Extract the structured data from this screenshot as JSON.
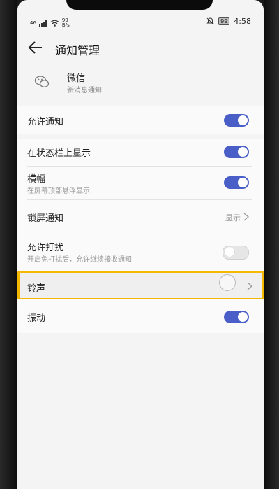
{
  "status_bar": {
    "signal_text": "46",
    "speed_top": "99",
    "speed_bottom": "B/s",
    "battery": "99",
    "time": "4:58"
  },
  "header": {
    "title": "通知管理"
  },
  "app": {
    "name": "微信",
    "subtitle": "新消息通知"
  },
  "settings": {
    "allow_notifications": {
      "label": "允许通知",
      "enabled": true
    },
    "status_bar_display": {
      "label": "在状态栏上显示",
      "enabled": true
    },
    "banner": {
      "label": "横幅",
      "sublabel": "在屏幕顶部悬浮显示",
      "enabled": true
    },
    "lock_screen": {
      "label": "锁屏通知",
      "value": "显示"
    },
    "dnd": {
      "label": "允许打扰",
      "sublabel": "开启免打扰后，允许继续接收通知",
      "enabled": false
    },
    "ringtone": {
      "label": "铃声"
    },
    "vibrate": {
      "label": "振动",
      "enabled": true
    }
  },
  "colors": {
    "accent": "#4a5ec8",
    "highlight_border": "#f5b800"
  }
}
